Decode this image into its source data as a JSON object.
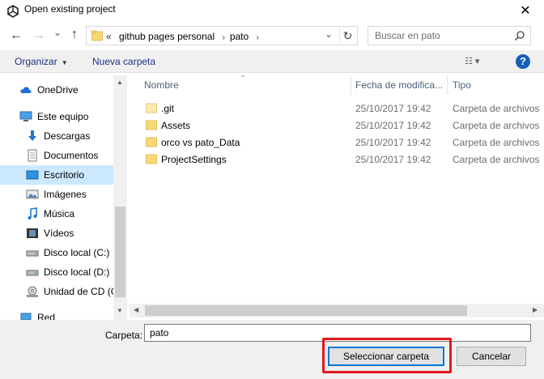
{
  "window": {
    "title": "Open existing project",
    "close_glyph": "✕"
  },
  "navigation": {
    "back_glyph": "←",
    "forward_glyph": "→",
    "recent_glyph": "⌄",
    "up_glyph": "↑",
    "address": {
      "overflow": "«",
      "crumbs": [
        "github pages personal",
        "pato"
      ],
      "separator": "›",
      "dropdown_glyph": "⌄",
      "refresh_glyph": "↻"
    },
    "search": {
      "placeholder": "Buscar en pato",
      "icon_glyph": "⚲"
    }
  },
  "toolbar": {
    "organize_label": "Organizar",
    "organize_arrow": "▼",
    "new_folder_label": "Nueva carpeta",
    "views_glyph": "☷ ▾",
    "help_glyph": "?"
  },
  "sidebar": {
    "items": [
      {
        "label": "OneDrive",
        "icon": "cloud-icon"
      },
      {
        "label": "Este equipo",
        "icon": "computer-icon"
      },
      {
        "label": "Descargas",
        "icon": "downloads-icon"
      },
      {
        "label": "Documentos",
        "icon": "documents-icon"
      },
      {
        "label": "Escritorio",
        "icon": "desktop-icon",
        "selected": true
      },
      {
        "label": "Imágenes",
        "icon": "pictures-icon"
      },
      {
        "label": "Música",
        "icon": "music-icon"
      },
      {
        "label": "Vídeos",
        "icon": "videos-icon"
      },
      {
        "label": "Disco local (C:)",
        "icon": "drive-icon"
      },
      {
        "label": "Disco local (D:)",
        "icon": "drive-icon"
      },
      {
        "label": "Unidad de CD (G",
        "icon": "cd-drive-icon"
      },
      {
        "label": "Red",
        "icon": "network-icon"
      }
    ],
    "scroll_up": "▲",
    "scroll_down": "▼"
  },
  "file_list": {
    "columns": [
      "Nombre",
      "Fecha de modifica...",
      "Tipo"
    ],
    "sort_glyph": "^",
    "rows": [
      {
        "name": ".git",
        "date": "25/10/2017 19:42",
        "type": "Carpeta de archivos"
      },
      {
        "name": "Assets",
        "date": "25/10/2017 19:42",
        "type": "Carpeta de archivos"
      },
      {
        "name": "orco vs pato_Data",
        "date": "25/10/2017 19:42",
        "type": "Carpeta de archivos"
      },
      {
        "name": "ProjectSettings",
        "date": "25/10/2017 19:42",
        "type": "Carpeta de archivos"
      }
    ],
    "scroll_left": "◀",
    "scroll_right": "▶"
  },
  "footer": {
    "folder_label": "Carpeta:",
    "folder_value": "pato",
    "select_button": "Seleccionar carpeta",
    "cancel_button": "Cancelar"
  },
  "colors": {
    "accent": "#0078d7",
    "selection": "#cce8ff",
    "highlight": "#e0191d",
    "folder": "#f8d775"
  }
}
